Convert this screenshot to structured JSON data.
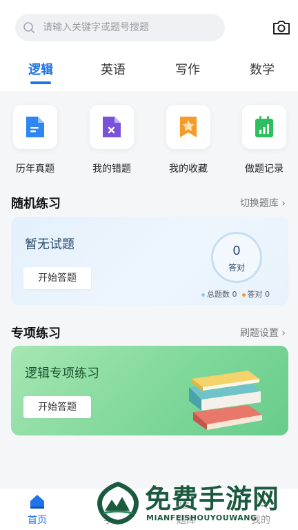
{
  "search": {
    "placeholder": "请输入关键字或题号搜题"
  },
  "tabs": [
    {
      "label": "逻辑",
      "active": true
    },
    {
      "label": "英语"
    },
    {
      "label": "写作"
    },
    {
      "label": "数学"
    }
  ],
  "quick": [
    {
      "label": "历年真题",
      "icon": "document-icon",
      "color": "#2d86f2"
    },
    {
      "label": "我的错题",
      "icon": "error-doc-icon",
      "color": "#7a52d9"
    },
    {
      "label": "我的收藏",
      "icon": "star-bookmark-icon",
      "color": "#f59b2a"
    },
    {
      "label": "做题记录",
      "icon": "chart-calendar-icon",
      "color": "#2fbf5f"
    }
  ],
  "random": {
    "title": "随机练习",
    "link": "切换题库",
    "card_title": "暂无试题",
    "button": "开始答题",
    "correct_count": "0",
    "correct_label": "答对",
    "total_label": "总题数 0",
    "correct_stat": "答对 0"
  },
  "special": {
    "title": "专项练习",
    "link": "刷题设置",
    "card_title": "逻辑专项练习",
    "button": "开始答题"
  },
  "nav": [
    {
      "label": "首页",
      "active": true
    },
    {
      "label": "学习"
    },
    {
      "label": "题库"
    },
    {
      "label": "我的"
    }
  ],
  "watermark": {
    "text": "免费手游网",
    "sub": "MIANFEISHOUYOUWANG"
  },
  "colors": {
    "accent": "#1e73e8",
    "green_card": "#7fd89a"
  }
}
